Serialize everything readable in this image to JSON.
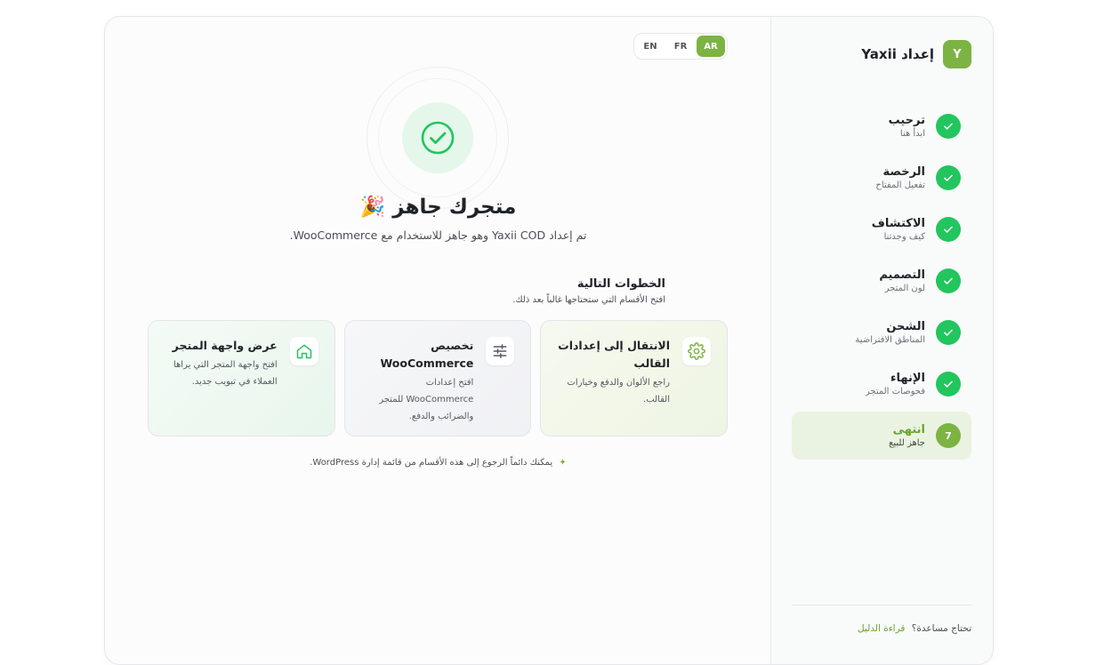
{
  "brand": {
    "title": "إعداد Yaxii",
    "logo_text": "Y"
  },
  "steps": [
    {
      "title": "ترحيب",
      "sub": "ابدأ هنا",
      "state": "done"
    },
    {
      "title": "الرخصة",
      "sub": "تفعيل المفتاح",
      "state": "done"
    },
    {
      "title": "الاكتشاف",
      "sub": "كيف وجدتنا",
      "state": "done"
    },
    {
      "title": "التصميم",
      "sub": "لون المتجر",
      "state": "done"
    },
    {
      "title": "الشحن",
      "sub": "المناطق الافتراضية",
      "state": "done"
    },
    {
      "title": "الإنهاء",
      "sub": "فحوصات المتجر",
      "state": "done"
    },
    {
      "title": "انتهى",
      "sub": "جاهز للبيع",
      "state": "active",
      "number": "7"
    }
  ],
  "help": {
    "question": "تحتاج مساعدة؟",
    "link": "قراءة الدليل"
  },
  "languages": {
    "en": "EN",
    "fr": "FR",
    "ar": "AR",
    "selected": "AR"
  },
  "hero": {
    "headline": "متجرك جاهز 🎉",
    "subline": "تم إعداد Yaxii COD وهو جاهز للاستخدام مع WooCommerce."
  },
  "next_steps": {
    "title": "الخطوات التالية",
    "sub": "افتح الأقسام التي ستحتاجها غالباً بعد ذلك.",
    "cards": [
      {
        "title": "الانتقال إلى إعدادات القالب",
        "desc": "راجع الألوان والدفع وخيارات القالب.",
        "icon": "gear-icon"
      },
      {
        "title": "تخصيص WooCommerce",
        "desc": "افتح إعدادات WooCommerce للمتجر والضرائب والدفع.",
        "icon": "sliders-icon"
      },
      {
        "title": "عرض واجهة المتجر",
        "desc": "افتح واجهة المتجر التي يراها العملاء في تبويب جديد.",
        "icon": "home-icon"
      }
    ]
  },
  "footnote": "يمكنك دائماً الرجوع إلى هذه الأقسام من قائمة إدارة WordPress.",
  "colors": {
    "accent": "#7cb342",
    "success": "#22c55e"
  }
}
